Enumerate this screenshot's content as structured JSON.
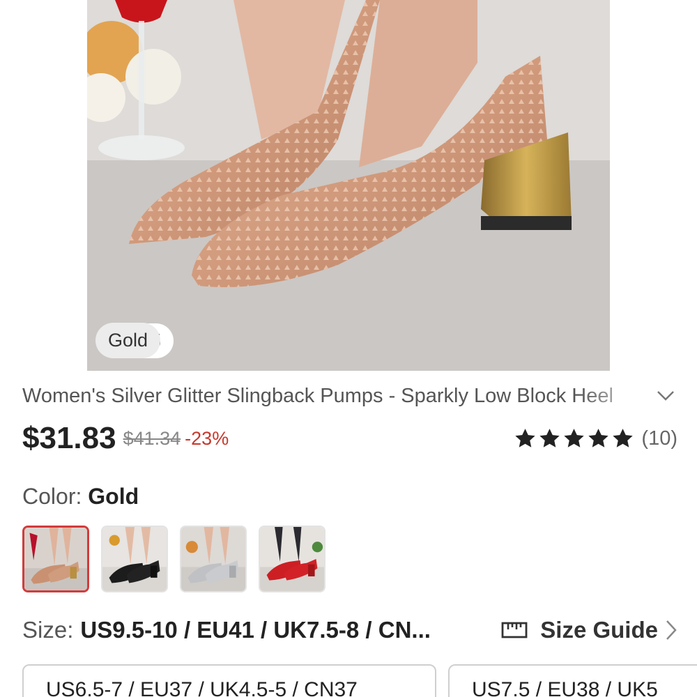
{
  "gallery": {
    "counter": "1/15",
    "color_chip": "Gold"
  },
  "product": {
    "title": "Women's Silver Glitter Slingback Pumps - Sparkly Low Block Heel",
    "price": "$31.83",
    "original_price": "$41.34",
    "discount": "-23%",
    "rating_stars": 5,
    "review_count": "(10)"
  },
  "color": {
    "label": "Color: ",
    "selected": "Gold",
    "swatches": [
      "Gold",
      "Black",
      "Silver",
      "Red"
    ]
  },
  "size": {
    "label": "Size:",
    "selected": "US9.5-10 / EU41 / UK7.5-8 / CN...",
    "guide_label": "Size Guide",
    "options": [
      "US6.5-7 / EU37 / UK4.5-5 / CN37",
      "US7.5 / EU38 / UK5"
    ]
  },
  "colors": {
    "accent_red": "#c7382b",
    "selected_border": "#d23c3c"
  },
  "icons": {
    "expand": "chevron-down-icon",
    "star": "star-icon",
    "ruler": "ruler-icon",
    "next": "chevron-right-icon"
  }
}
